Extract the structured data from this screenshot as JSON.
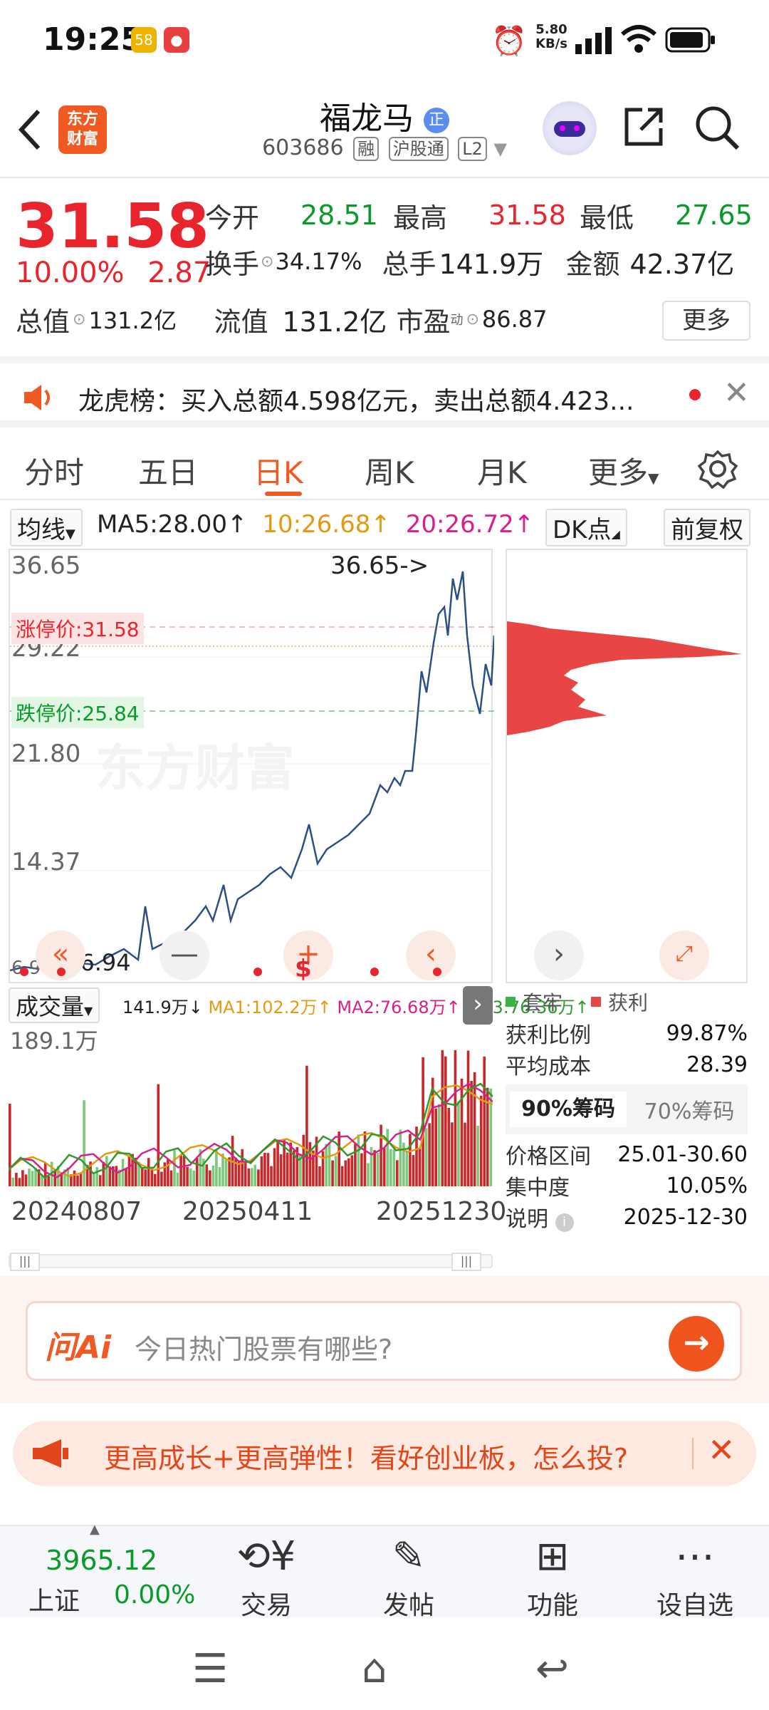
{
  "status": {
    "time": "19:25",
    "speed_value": "5.80",
    "speed_unit": "KB/s"
  },
  "header": {
    "stock_name": "福龙马",
    "badge": "正",
    "code": "603686",
    "tags": [
      "融",
      "沪股通",
      "L2"
    ],
    "logo_line1": "东方",
    "logo_line2": "财富"
  },
  "quote": {
    "price": "31.58",
    "change_pct": "10.00%",
    "change_amt": "2.87",
    "items": {
      "open_label": "今开",
      "open": "28.51",
      "high_label": "最高",
      "high": "31.58",
      "low_label": "最低",
      "low": "27.65",
      "turnover_label": "换手",
      "turnover": "34.17%",
      "volume_label": "总手",
      "volume": "141.9万",
      "amount_label": "金额",
      "amount": "42.37亿",
      "mktcap_label": "总值",
      "mktcap": "131.2亿",
      "float_label": "流值",
      "float": "131.2亿",
      "pe_label": "市盈",
      "pe_sup": "动",
      "pe": "86.87"
    },
    "more": "更多"
  },
  "notice": {
    "text": "龙虎榜：买入总额4.598亿元，卖出总额4.423..."
  },
  "tabs": [
    {
      "label": "分时"
    },
    {
      "label": "五日"
    },
    {
      "label": "日K"
    },
    {
      "label": "周K"
    },
    {
      "label": "月K"
    },
    {
      "label": "更多"
    }
  ],
  "ma_bar": {
    "ma_select": "均线",
    "ma5": "MA5:28.00",
    "ma10": "10:26.68",
    "ma20": "20:26.72",
    "dk": "DK点",
    "adjust": "前复权"
  },
  "kchart": {
    "y_top": "36.65",
    "y_mid1": "29.22",
    "y_mid2": "21.80",
    "y_mid3": "14.37",
    "y_bottom": "6.94",
    "high_marker": "36.65->",
    "low_marker": "<-6.94",
    "limit_up": "涨停价:31.58",
    "limit_down": "跌停价:25.84",
    "watermark": "东方财富"
  },
  "volume": {
    "select": "成交量",
    "v": "141.9万",
    "ma1": "MA1:102.2万",
    "ma2": "MA2:76.68万",
    "ma3": "MA3:76.36万",
    "max": "189.1万",
    "dates": [
      "20240807",
      "20250411",
      "20251230"
    ]
  },
  "chips": {
    "legend_hold": "套牢",
    "legend_profit": "获利",
    "rows": [
      {
        "label": "获利比例",
        "value": "99.87%"
      },
      {
        "label": "平均成本",
        "value": "28.39"
      }
    ],
    "tab1": "90%筹码",
    "tab2": "70%筹码",
    "rows2": [
      {
        "label": "价格区间",
        "value": "25.01-30.60"
      },
      {
        "label": "集中度",
        "value": "10.05%"
      },
      {
        "label": "说明",
        "value": "2025-12-30"
      }
    ]
  },
  "ai": {
    "logo": "问Ai",
    "placeholder": "今日热门股票有哪些?"
  },
  "promo": {
    "text": "更高成长+更高弹性！看好创业板，怎么投?"
  },
  "bottom_nav": {
    "index_value": "3965.12",
    "index_name": "上证",
    "index_change": "0.00%",
    "items": [
      {
        "label": "交易"
      },
      {
        "label": "发帖"
      },
      {
        "label": "功能"
      },
      {
        "label": "设自选"
      }
    ]
  },
  "colors": {
    "up": "#e8242c",
    "down": "#0a9a2a",
    "brand": "#f05a22",
    "line": "#2c4f86"
  }
}
